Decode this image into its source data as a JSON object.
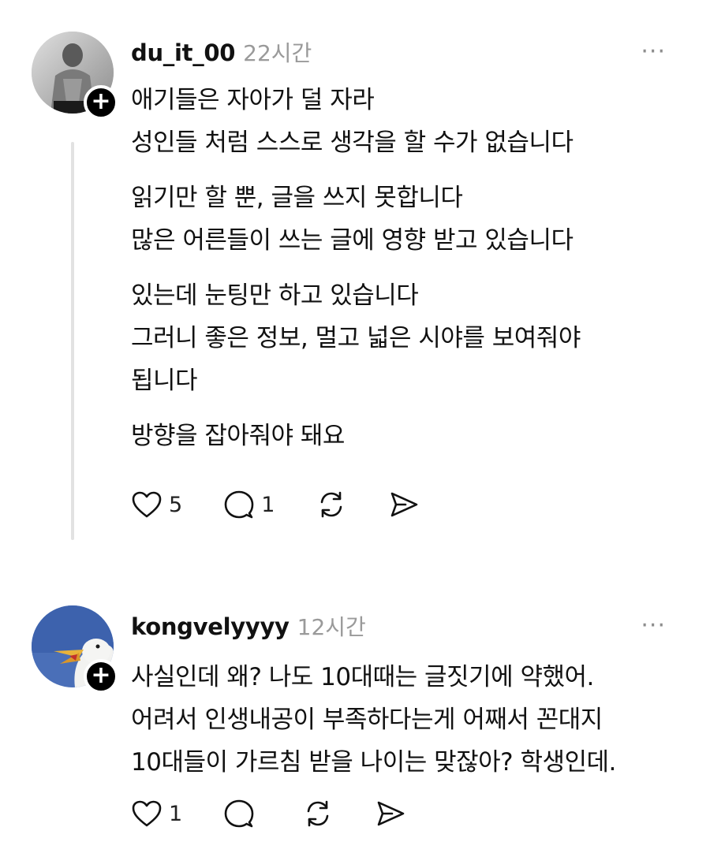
{
  "posts": [
    {
      "username": "du_it_00",
      "time": "22시간",
      "more_label": "···",
      "avatar_icon": "profile-photo-shirtless-man",
      "paragraphs": [
        [
          "애기들은 자아가 덜 자라",
          "성인들 처럼 스스로 생각을 할 수가 없습니다"
        ],
        [
          "읽기만 할 뿐, 글을 쓰지 못합니다",
          "많은 어른들이 쓰는 글에 영향 받고 있습니다"
        ],
        [
          "있는데 눈팅만 하고 있습니다",
          "그러니 좋은 정보, 멀고 넓은 시야를 보여줘야",
          "됩니다"
        ],
        [
          "방향을 잡아줘야 돼요"
        ]
      ],
      "likes": "5",
      "replies": "1"
    },
    {
      "username": "kongvelyyyy",
      "time": "12시간",
      "more_label": "···",
      "avatar_icon": "profile-photo-seagull",
      "paragraphs": [
        [
          "사실인데 왜? 나도 10대때는 글짓기에 약했어.",
          "어려서 인생내공이 부족하다는게 어째서 꼰대지",
          "10대들이 가르침 받을 나이는 맞잖아? 학생인데."
        ]
      ],
      "likes": "1",
      "replies": ""
    }
  ],
  "colors": {
    "text": "#111111",
    "muted": "#9a9a9a",
    "thread_line": "#e2e2e2"
  }
}
